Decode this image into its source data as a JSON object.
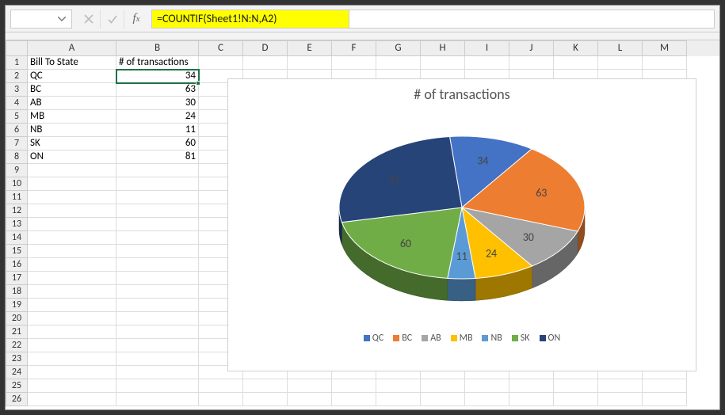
{
  "formula_bar": {
    "name_box": "",
    "formula": "=COUNTIF(Sheet1!N:N,A2)"
  },
  "columns": [
    "A",
    "B",
    "C",
    "D",
    "E",
    "F",
    "G",
    "H",
    "I",
    "J",
    "K",
    "L",
    "M"
  ],
  "row_count": 26,
  "data": {
    "A1": "Bill To State",
    "B1": "# of transactions",
    "A2": "QC",
    "B2": "34",
    "A3": "BC",
    "B3": "63",
    "A4": "AB",
    "B4": "30",
    "A5": "MB",
    "B5": "24",
    "A6": "NB",
    "B6": "11",
    "A7": "SK",
    "B7": "60",
    "A8": "ON",
    "B8": "81"
  },
  "selected_cell": "B2",
  "chart_data": {
    "type": "pie",
    "title": "# of transactions",
    "categories": [
      "QC",
      "BC",
      "AB",
      "MB",
      "NB",
      "SK",
      "ON"
    ],
    "values": [
      34,
      63,
      30,
      24,
      11,
      60,
      81
    ],
    "colors": [
      "#4472c4",
      "#ed7d31",
      "#a5a5a5",
      "#ffc000",
      "#5b9bd5",
      "#70ad47",
      "#264478"
    ],
    "legend_position": "bottom",
    "show_data_labels": true
  }
}
